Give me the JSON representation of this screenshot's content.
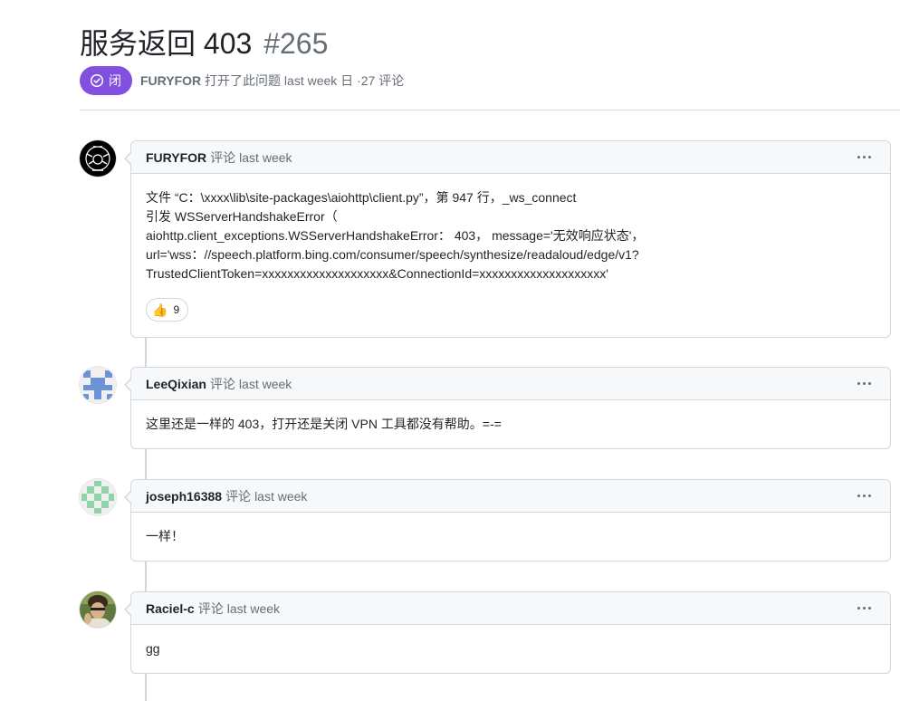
{
  "issue": {
    "title": "服务返回 403",
    "number": "#265",
    "state_label": "闭",
    "author": "FURYFOR",
    "opened_text": "打开了此问题 last week 日 ·27 评论"
  },
  "colors": {
    "closed_badge": "#8250df",
    "border": "#d0d7de",
    "header_bg": "#f6f8fa",
    "muted_text": "#656d76"
  },
  "comments": [
    {
      "author": "FURYFOR",
      "action": "评论",
      "time": "last week",
      "avatar_icon": "black-emblem-avatar",
      "body": [
        "文件 “C：\\xxxx\\lib\\site-packages\\aiohttp\\client.py”，第 947 行，_ws_connect",
        "引发 WSServerHandshakeError（",
        "aiohttp.client_exceptions.WSServerHandshakeError： 403， message='无效响应状态'，",
        "url='wss：//speech.platform.bing.com/consumer/speech/synthesize/readaloud/edge/v1?",
        "TrustedClientToken=xxxxxxxxxxxxxxxxxxxx&ConnectionId=xxxxxxxxxxxxxxxxxxxx'"
      ],
      "reaction": {
        "icon": "thumbs-up-icon",
        "emoji": "👍",
        "count": "9"
      }
    },
    {
      "author": "LeeQixian",
      "action": "评论",
      "time": "last week",
      "avatar_icon": "blue-identicon-avatar",
      "body": [
        "这里还是一样的 403，打开还是关闭 VPN 工具都没有帮助。=-="
      ]
    },
    {
      "author": "joseph16388",
      "action": "评论",
      "time": "last week",
      "avatar_icon": "green-identicon-avatar",
      "body": [
        "一样！"
      ]
    },
    {
      "author": "Raciel-c",
      "action": "评论",
      "time": "last week",
      "avatar_icon": "photo-avatar",
      "body": [
        "gg"
      ]
    }
  ]
}
